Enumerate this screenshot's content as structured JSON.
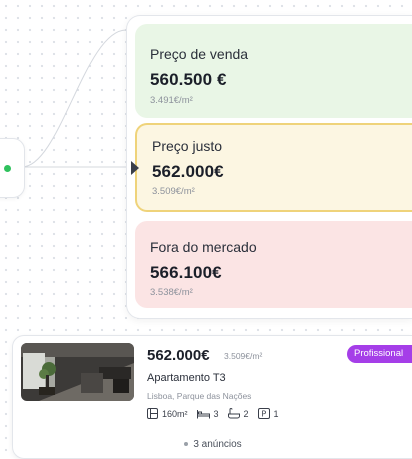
{
  "valuation": {
    "sale": {
      "label": "Preço de venda",
      "price": "560.500 €",
      "per_m2": "3.491€/m²"
    },
    "fair": {
      "label": "Preço justo",
      "price": "562.000€",
      "per_m2": "3.509€/m²"
    },
    "out": {
      "label": "Fora do mercado",
      "price": "566.100€",
      "per_m2": "3.538€/m²"
    }
  },
  "listing": {
    "price": "562.000€",
    "per_m2": "3.509€/m²",
    "badge": "Profissional",
    "type": "Apartamento T3",
    "location": "Lisboa, Parque das Nações",
    "area": "160m²",
    "bedrooms": "3",
    "bathrooms": "2",
    "parking": "1",
    "listings_count": "3 anúncios"
  },
  "colors": {
    "sale_bg": "#e9f6e6",
    "fair_bg": "#fcf6e2",
    "fair_border": "#efd37a",
    "out_bg": "#fbe4e4",
    "badge": "#a53ee8",
    "status_dot": "#2fc15d"
  }
}
